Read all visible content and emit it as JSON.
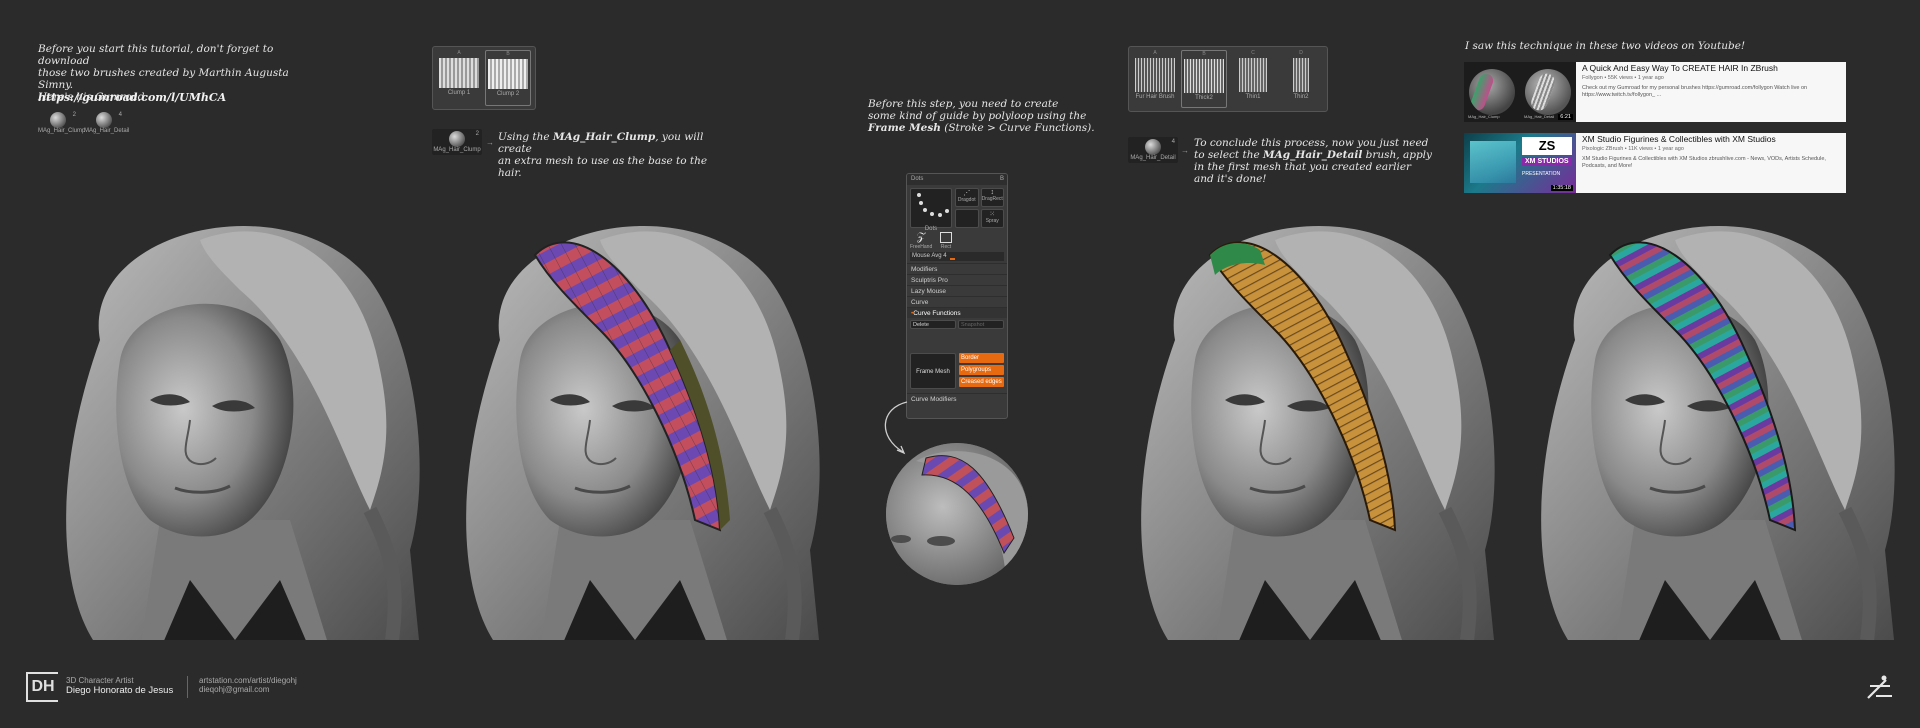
{
  "intro": {
    "line1": "Before you start this tutorial, don't forget to download",
    "line2": "those two brushes created by Marthin Augusta Simny.",
    "line3": "Here's his Gumroad:",
    "link": "https://gumroad.com/l/UMhCA",
    "brushes": [
      {
        "label": "MAg_Hair_Clump",
        "num": "2"
      },
      {
        "label": "MAg_Hair_Detail",
        "num": "4"
      }
    ]
  },
  "step1": {
    "tabs": [
      {
        "label": "Clump 1",
        "key": "A"
      },
      {
        "label": "Clump 2",
        "key": "B"
      }
    ],
    "brush": {
      "label": "MAg_Hair_Clump",
      "num": "2"
    },
    "note_pre": "Using the ",
    "note_bold": "MAg_Hair_Clump",
    "note_post": ", you will create",
    "note_line2": "an extra mesh to use as the base to the hair."
  },
  "step2": {
    "line1": "Before this step, you need to create",
    "line2": "some kind of guide by polyloop using the",
    "line3_bold": "Frame Mesh",
    "line3_rest": " (Stroke > Curve Functions).",
    "panel": {
      "header": "Dots",
      "header_key": "B",
      "icons": [
        "Dots",
        "Dragdot",
        "DragRect",
        "Spray"
      ],
      "icons2": [
        "FreeHand",
        "Rect"
      ],
      "mouse_avg": "Mouse Avg 4",
      "menu": [
        "Modifiers",
        "Sculptris Pro",
        "Lazy Mouse",
        "Curve",
        "Curve Functions"
      ],
      "delete_label": "Delete",
      "snapshot_label": "Snapshot",
      "frame_mesh": "Frame Mesh",
      "frame_options": [
        "Border",
        "Polygroups",
        "Creased edges"
      ],
      "curve_modifiers": "Curve Modifiers"
    }
  },
  "step3": {
    "tabs": [
      {
        "label": "Fur Hair Brush",
        "key": "A"
      },
      {
        "label": "Thick2",
        "key": "B"
      },
      {
        "label": "Thin1",
        "key": "C"
      },
      {
        "label": "Thin2",
        "key": "D"
      }
    ],
    "brush": {
      "label": "MAg_Hair_Detail",
      "num": "4"
    },
    "line1": "To conclude this process, now you just need",
    "line2_pre": "to select the ",
    "line2_bold": "MAg_Hair_Detail",
    "line2_post": " brush, apply",
    "line3": "in the first mesh that you created earlier",
    "line4": "and it's done!"
  },
  "videos": {
    "heading": "I saw this technique in these two videos on Youtube!",
    "items": [
      {
        "title": "A Quick And Easy Way To CREATE HAIR In ZBrush",
        "meta": "Follygon • 55K views • 1 year ago",
        "desc": "Check out my Gumroad for my personal brushes https://gumroad.com/follygon Watch live on https://www.twitch.tv/follygon_ ...",
        "duration": "6:21",
        "thumb_labels": [
          "MAg_Hair_Clump",
          "MAg_Hair_Detail"
        ]
      },
      {
        "title": "XM Studio Figurines & Collectibles with XM Studios",
        "meta": "Pixologic ZBrush • 11K views • 1 year ago",
        "desc": "XM Studio Figurines & Collectibles with XM Studios zbrushlive.com - News, VODs, Artists Schedule, Podcasts, and More!",
        "duration": "1:35:18",
        "thumb_text1": "ZS",
        "thumb_text2": "XM STUDIOS",
        "thumb_text3": "PRESENTATION"
      }
    ]
  },
  "footer": {
    "logo": "DH",
    "role": "3D Character Artist",
    "name": "Diego Honorato de Jesus",
    "site": "artstation.com/artist/diegohj",
    "email": "dieqohj@gmail.com"
  },
  "colors": {
    "bg": "#2b2b2b",
    "accent": "#e86a10",
    "clay": "#8a8a8a"
  }
}
